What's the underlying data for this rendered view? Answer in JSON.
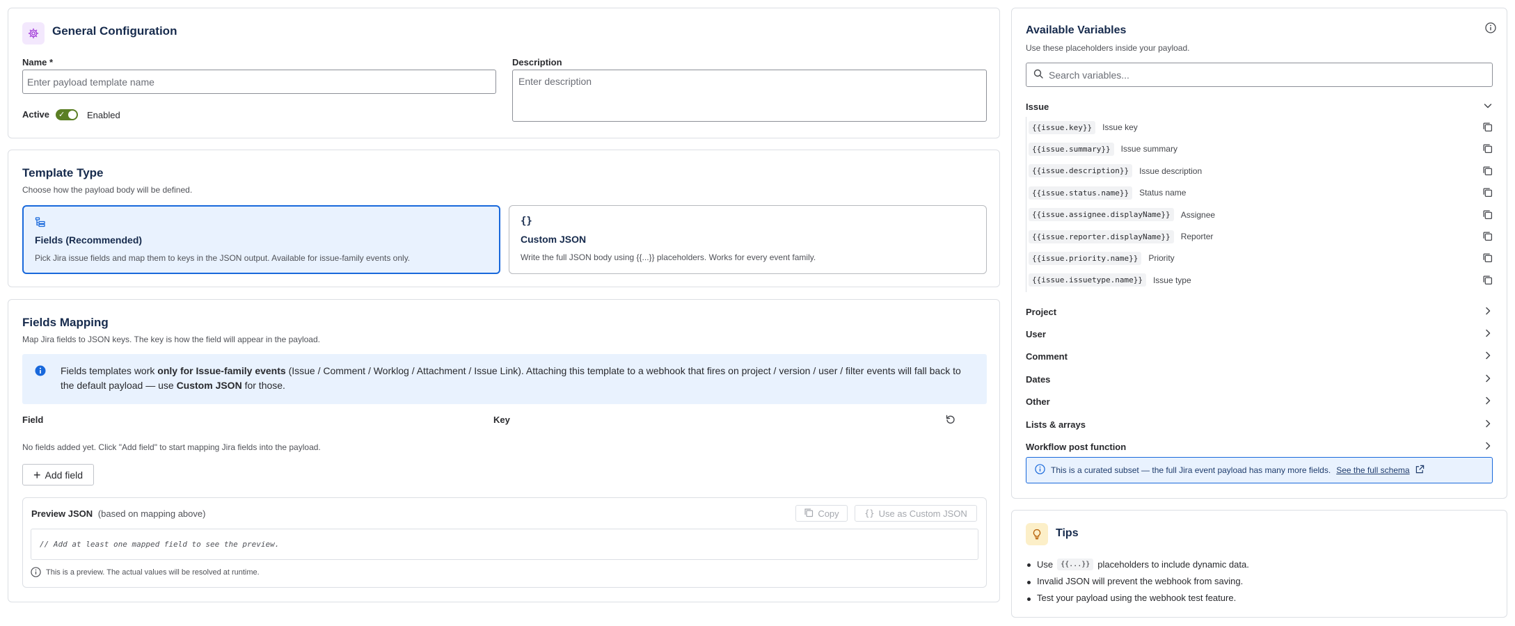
{
  "general": {
    "title": "General Configuration",
    "name_label": "Name *",
    "name_placeholder": "Enter payload template name",
    "description_label": "Description",
    "description_placeholder": "Enter description",
    "active_label": "Active",
    "active_state": "Enabled"
  },
  "template_type": {
    "title": "Template Type",
    "subtitle": "Choose how the payload body will be defined.",
    "options": [
      {
        "icon": "fields-icon",
        "title": "Fields (Recommended)",
        "description": "Pick Jira issue fields and map them to keys in the JSON output. Available for issue-family events only.",
        "selected": true
      },
      {
        "icon_text": "{}",
        "title": "Custom JSON",
        "description": "Write the full JSON body using {{...}} placeholders. Works for every event family.",
        "selected": false
      }
    ]
  },
  "fields_mapping": {
    "title": "Fields Mapping",
    "subtitle": "Map Jira fields to JSON keys. The key is how the field will appear in the payload.",
    "info_pre": "Fields templates work ",
    "info_bold": "only for Issue-family events",
    "info_mid": " (Issue / Comment / Worklog / Attachment / Issue Link). Attaching this template to a webhook that fires on project / version / user / filter events will fall back to the default payload — use ",
    "info_bold2": "Custom JSON",
    "info_post": " for those.",
    "col_field": "Field",
    "col_key": "Key",
    "empty_text": "No fields added yet. Click \"Add field\" to start mapping Jira fields into the payload.",
    "add_field": "Add field",
    "preview_title": "Preview JSON",
    "preview_hint": "(based on mapping above)",
    "copy": "Copy",
    "use_custom": "Use as Custom JSON",
    "code_placeholder": "// Add at least one mapped field to see the preview.",
    "runtime_note": "This is a preview. The actual values will be resolved at runtime."
  },
  "variables": {
    "title": "Available Variables",
    "subtitle": "Use these placeholders inside your payload.",
    "search_placeholder": "Search variables...",
    "issue_group": "Issue",
    "issue_vars": [
      {
        "code": "{{issue.key}}",
        "label": "Issue key"
      },
      {
        "code": "{{issue.summary}}",
        "label": "Issue summary"
      },
      {
        "code": "{{issue.description}}",
        "label": "Issue description"
      },
      {
        "code": "{{issue.status.name}}",
        "label": "Status name"
      },
      {
        "code": "{{issue.assignee.displayName}}",
        "label": "Assignee"
      },
      {
        "code": "{{issue.reporter.displayName}}",
        "label": "Reporter"
      },
      {
        "code": "{{issue.priority.name}}",
        "label": "Priority"
      },
      {
        "code": "{{issue.issuetype.name}}",
        "label": "Issue type"
      }
    ],
    "groups": [
      "Project",
      "User",
      "Comment",
      "Dates",
      "Other",
      "Lists & arrays",
      "Workflow post function"
    ],
    "note": "This is a curated subset — the full Jira event payload has many more fields.",
    "note_link": "See the full schema"
  },
  "tips": {
    "title": "Tips",
    "item1_pre": "Use",
    "item1_code": "{{...}}",
    "item1_post": "placeholders to include dynamic data.",
    "item2": "Invalid JSON will prevent the webhook from saving.",
    "item3": "Test your payload using the webhook test feature."
  },
  "colors": {
    "accent": "#1868db",
    "toggle_on": "#5b7f24",
    "info_bg": "#e9f2fe"
  }
}
